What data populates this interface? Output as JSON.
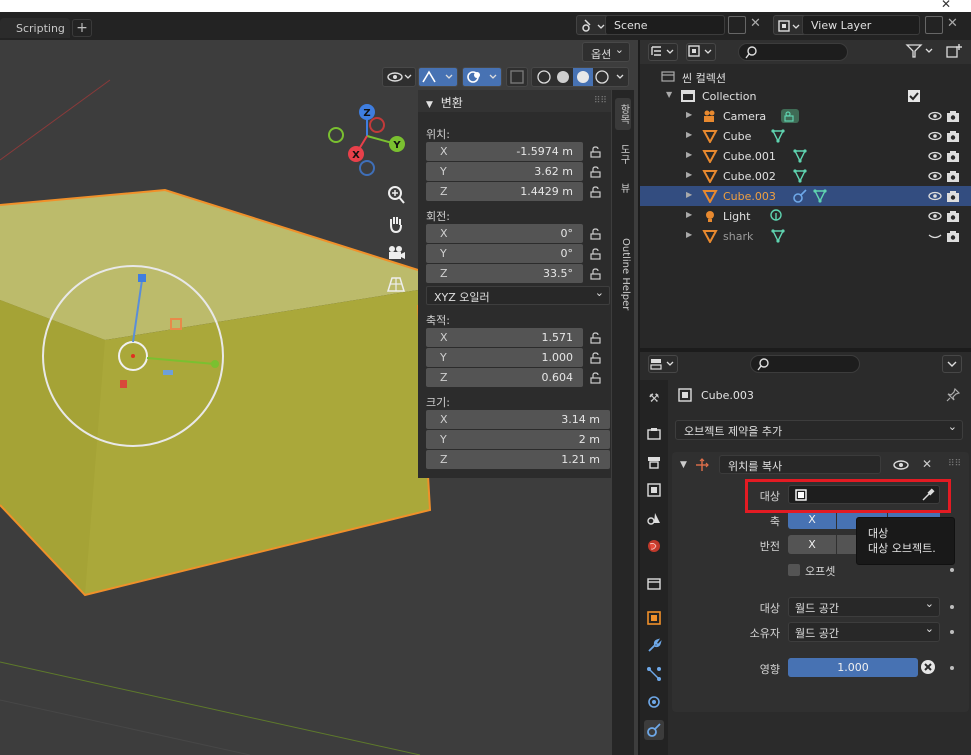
{
  "header": {
    "workspace_tab": "Scripting",
    "add_tab": "+",
    "scene_label": "Scene",
    "view_layer_label": "View Layer",
    "close_glyph": "✕"
  },
  "viewport": {
    "options_label": "옵션",
    "dropdown_glyph": "⌄",
    "axis_labels": {
      "x": "X",
      "y": "Y",
      "z": "Z"
    }
  },
  "sidetabs": [
    "항목",
    "도구",
    "뷰",
    "Outline Helper"
  ],
  "npanel": {
    "title": "변환",
    "location_label": "위치:",
    "location": [
      {
        "axis": "X",
        "value": "-1.5974 m"
      },
      {
        "axis": "Y",
        "value": "3.62 m"
      },
      {
        "axis": "Z",
        "value": "1.4429 m"
      }
    ],
    "rotation_label": "회전:",
    "rotation": [
      {
        "axis": "X",
        "value": "0°"
      },
      {
        "axis": "Y",
        "value": "0°"
      },
      {
        "axis": "Z",
        "value": "33.5°"
      }
    ],
    "rotation_mode": "XYZ 오일러",
    "scale_label": "축적:",
    "scale": [
      {
        "axis": "X",
        "value": "1.571"
      },
      {
        "axis": "Y",
        "value": "1.000"
      },
      {
        "axis": "Z",
        "value": "0.604"
      }
    ],
    "dimensions_label": "크기:",
    "dimensions": [
      {
        "axis": "X",
        "value": "3.14 m"
      },
      {
        "axis": "Y",
        "value": "2 m"
      },
      {
        "axis": "Z",
        "value": "1.21 m"
      }
    ]
  },
  "outliner": {
    "root": "씬 컬렉션",
    "collection": "Collection",
    "items": [
      "Camera",
      "Cube",
      "Cube.001",
      "Cube.002",
      "Cube.003",
      "Light",
      "shark"
    ],
    "selected": "Cube.003"
  },
  "properties": {
    "object_name": "Cube.003",
    "add_constraint": "오브젝트 제약을 추가",
    "constraint_name": "위치를 복사",
    "target_label": "대상",
    "axis_label": "축",
    "axis_x": "X",
    "invert_label": "반전",
    "invert_x": "X",
    "offset_label": "오프셋",
    "target_space_label": "대상",
    "target_space_value": "월드 공간",
    "owner_space_label": "소유자",
    "owner_space_value": "월드 공간",
    "influence_label": "영향",
    "influence_value": "1.000",
    "influence": 1.0
  },
  "tooltip": {
    "title": "대상",
    "description": "대상 오브젝트."
  },
  "colors": {
    "object_yellow": "#c9c24a",
    "selection_orange": "#f0902a",
    "selected_row": "#334d80",
    "highlight_red": "#e31b23",
    "toggle_blue": "#4772b3"
  }
}
